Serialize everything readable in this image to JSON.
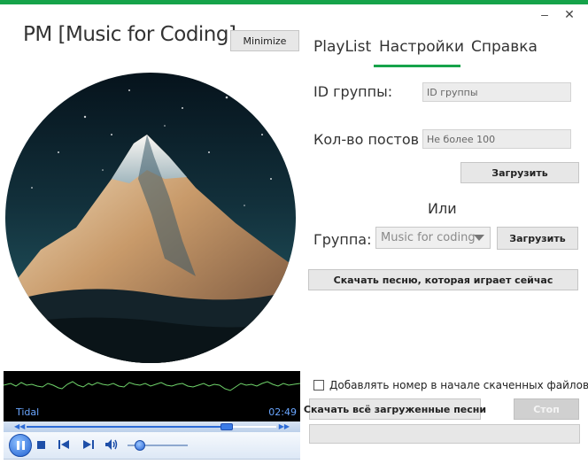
{
  "window": {
    "minimize_glyph": "–",
    "close_glyph": "✕",
    "accent_color": "#16a34a"
  },
  "header": {
    "title": "PM [Music for Coding]",
    "minimize_button": "Minimize"
  },
  "tabs": [
    {
      "label": "PlayList",
      "active": false
    },
    {
      "label": "Настройки",
      "active": true
    },
    {
      "label": "Справка",
      "active": false
    }
  ],
  "settings": {
    "group_id_label": "ID группы:",
    "group_id_placeholder": "ID группы",
    "post_count_label": "Кол-во постов",
    "post_count_placeholder": "Не более 100",
    "load_button": "Загрузить",
    "or_label": "Или",
    "group_label": "Группа:",
    "group_selected": "Music for coding",
    "group_load_button": "Загрузить",
    "download_current_button": "Скачать песню, которая играет сейчас"
  },
  "downloads": {
    "checkbox_label": "Добавлять номер в начале скаченных файлов?",
    "checkbox_checked": false,
    "download_all_button": "Скачать всё загруженные песни",
    "stop_button": "Стоп",
    "progress": 0
  },
  "player": {
    "source": "Tidal",
    "time": "02:49",
    "seek_position": 0.8,
    "volume": 0.2,
    "icons": [
      "pause-icon",
      "stop-icon",
      "previous-icon",
      "next-icon",
      "volume-icon"
    ]
  }
}
